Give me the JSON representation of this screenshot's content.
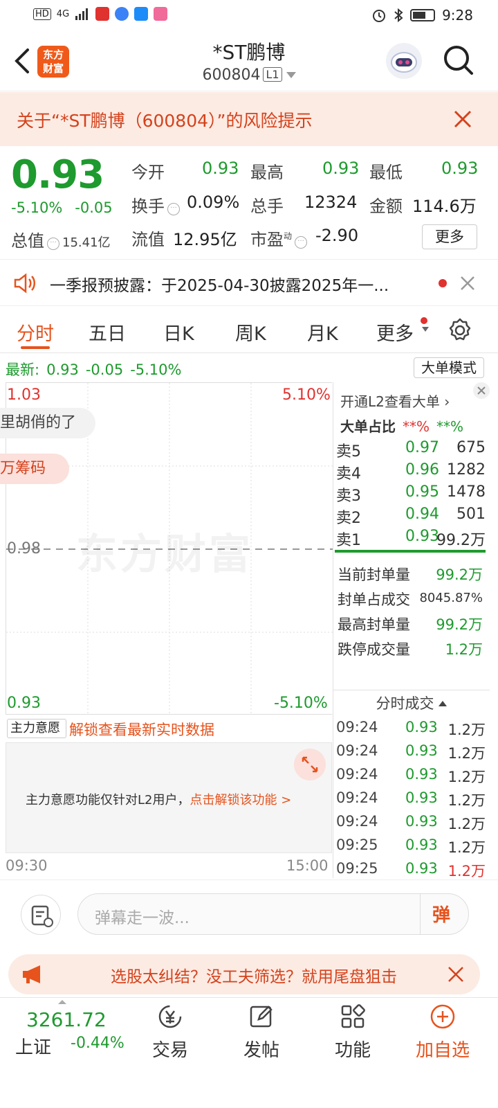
{
  "statusbar": {
    "time": "9:28",
    "net": "HD",
    "signal": "4G"
  },
  "header": {
    "logo_text_1": "东方",
    "logo_text_2": "财富",
    "title": "*ST鹏博",
    "code": "600804",
    "level": "L1"
  },
  "risk_banner": {
    "text": "关于“*ST鹏博（600804）”的风险提示"
  },
  "quote": {
    "price": "0.93",
    "change_pct": "-5.10%",
    "change": "-0.05",
    "mktcap_label": "总值",
    "mktcap_value": "15.41亿",
    "open_label": "今开",
    "open_value": "0.93",
    "high_label": "最高",
    "high_value": "0.93",
    "low_label": "最低",
    "low_value": "0.93",
    "turnover_label": "换手",
    "turnover_value": "0.09%",
    "volume_label": "总手",
    "volume_value": "12324",
    "amount_label": "金额",
    "amount_value": "114.6万",
    "float_label": "流值",
    "float_value": "12.95亿",
    "pe_label": "市盈",
    "pe_sup": "动",
    "pe_value": "-2.90",
    "more_label": "更多"
  },
  "notice": {
    "text": "一季报预披露：于2025-04-30披露2025年一..."
  },
  "tabs": {
    "t1": "分时",
    "t2": "五日",
    "t3": "日K",
    "t4": "周K",
    "t5": "月K",
    "t6": "更多"
  },
  "latest": {
    "label": "最新:",
    "price": "0.93",
    "change": "-0.05",
    "pct": "-5.10%",
    "mode_btn": "大单模式"
  },
  "chart": {
    "y_top": "1.03",
    "y_mid": "0.98",
    "y_bottom": "0.93",
    "pct_top": "5.10%",
    "pct_bottom": "-5.10%",
    "watermark": "东方财富",
    "bubble1": "里胡俏的了",
    "bubble2": "万筹码",
    "time_start": "09:30",
    "time_end": "15:00"
  },
  "main_force": {
    "select": "主力意愿",
    "unlock": "解锁查看最新实时数据",
    "msg": "主力意愿功能仅针对L2用户，",
    "msg_link": "点击解锁该功能 >"
  },
  "right_panel": {
    "l2_link": "开通L2查看大单",
    "big_ratio_label": "大单占比",
    "big_ratio_red": "**%",
    "big_ratio_green": "**%",
    "book": [
      {
        "label": "卖5",
        "price": "0.97",
        "vol": "675"
      },
      {
        "label": "卖4",
        "price": "0.96",
        "vol": "1282"
      },
      {
        "label": "卖3",
        "price": "0.95",
        "vol": "1478"
      },
      {
        "label": "卖2",
        "price": "0.94",
        "vol": "501"
      },
      {
        "label": "卖1",
        "price": "0.93",
        "vol": "99.2万"
      }
    ],
    "seal": [
      {
        "label": "当前封单量",
        "value": "99.2万"
      },
      {
        "label": "封单占成交",
        "value": "8045.87%"
      },
      {
        "label": "最高封单量",
        "value": "99.2万"
      },
      {
        "label": "跌停成交量",
        "value": "1.2万"
      }
    ],
    "ticks_title": "分时成交",
    "ticks": [
      {
        "time": "09:24",
        "price": "0.93",
        "vol": "1.2万"
      },
      {
        "time": "09:24",
        "price": "0.93",
        "vol": "1.2万"
      },
      {
        "time": "09:24",
        "price": "0.93",
        "vol": "1.2万"
      },
      {
        "time": "09:24",
        "price": "0.93",
        "vol": "1.2万"
      },
      {
        "time": "09:24",
        "price": "0.93",
        "vol": "1.2万"
      },
      {
        "time": "09:25",
        "price": "0.93",
        "vol": "1.2万"
      },
      {
        "time": "09:25",
        "price": "0.93",
        "vol": "1.2万"
      }
    ]
  },
  "comment": {
    "placeholder": "弹幕走一波...",
    "shoot": "弹"
  },
  "promo": {
    "text": "选股太纠结？没工夫筛选？就用尾盘狙击"
  },
  "bottom_nav": {
    "index_value": "3261.72",
    "index_name": "上证",
    "index_pct": "-0.44%",
    "trade": "交易",
    "post": "发帖",
    "func": "功能",
    "add": "加自选"
  },
  "colors": {
    "green": "#1e9a2e",
    "red": "#e0322f",
    "accent": "#e6531d"
  }
}
